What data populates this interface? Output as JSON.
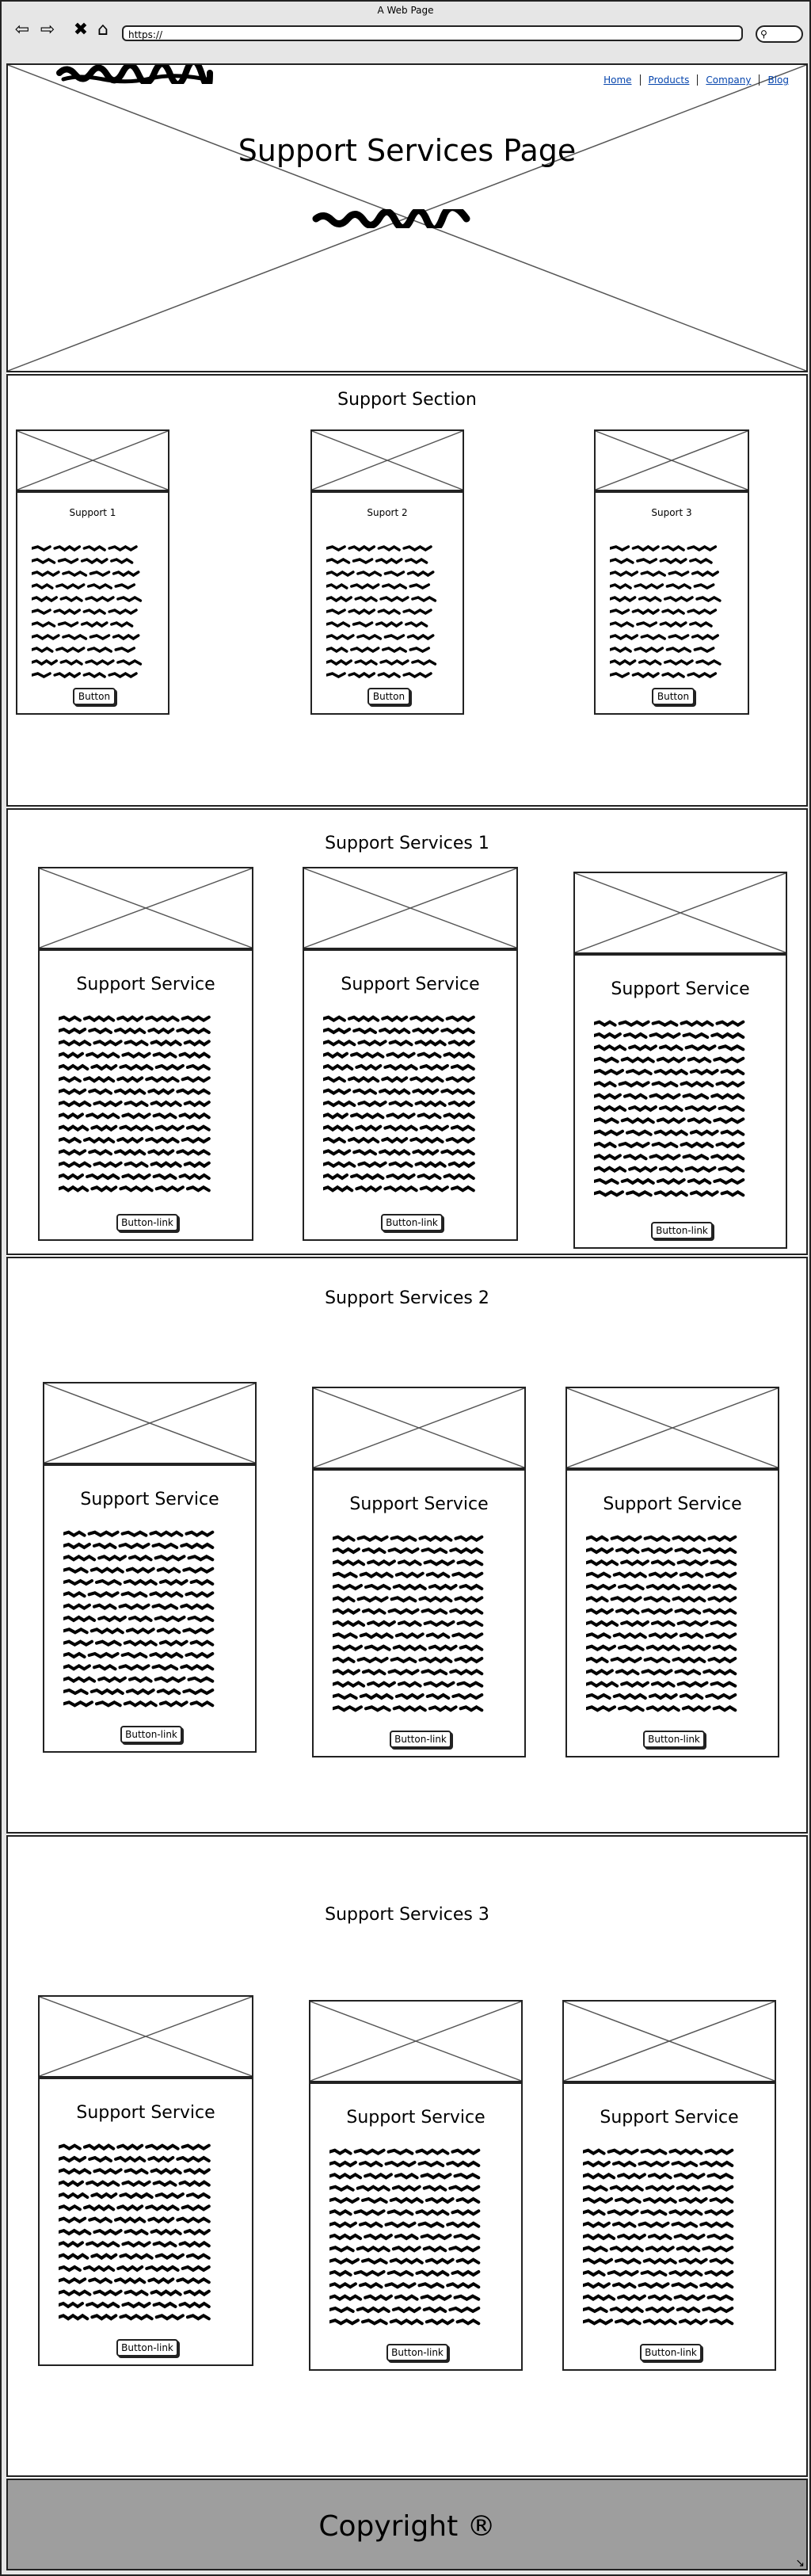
{
  "browser": {
    "window_title": "A Web Page",
    "url": "https://",
    "back_icon": "back-arrow-icon",
    "forward_icon": "forward-arrow-icon",
    "close_icon": "close-icon",
    "home_icon": "home-icon",
    "search_icon": "search-icon"
  },
  "header": {
    "title": "Support Services Page",
    "nav": [
      "Home",
      "Products",
      "Company",
      "Blog"
    ]
  },
  "support_section": {
    "title": "Support Section",
    "cards": [
      {
        "label": "Support 1",
        "button": "Button"
      },
      {
        "label": "Suport 2",
        "button": "Button"
      },
      {
        "label": "Suport 3",
        "button": "Button"
      }
    ]
  },
  "services_1": {
    "title": "Support Services 1",
    "cards": [
      {
        "heading": "Support Service",
        "button": "Button-link"
      },
      {
        "heading": "Support Service",
        "button": "Button-link"
      },
      {
        "heading": "Support Service",
        "button": "Button-link"
      }
    ]
  },
  "services_2": {
    "title": "Support Services 2",
    "cards": [
      {
        "heading": "Support Service",
        "button": "Button-link"
      },
      {
        "heading": "Support Service",
        "button": "Button-link"
      },
      {
        "heading": "Support Service",
        "button": "Button-link"
      }
    ]
  },
  "services_3": {
    "title": "Support Services 3",
    "cards": [
      {
        "heading": "Support Service",
        "button": "Button-link"
      },
      {
        "heading": "Support Service",
        "button": "Button-link"
      },
      {
        "heading": "Support Service",
        "button": "Button-link"
      }
    ]
  },
  "footer": {
    "text": "Copyright ®"
  }
}
